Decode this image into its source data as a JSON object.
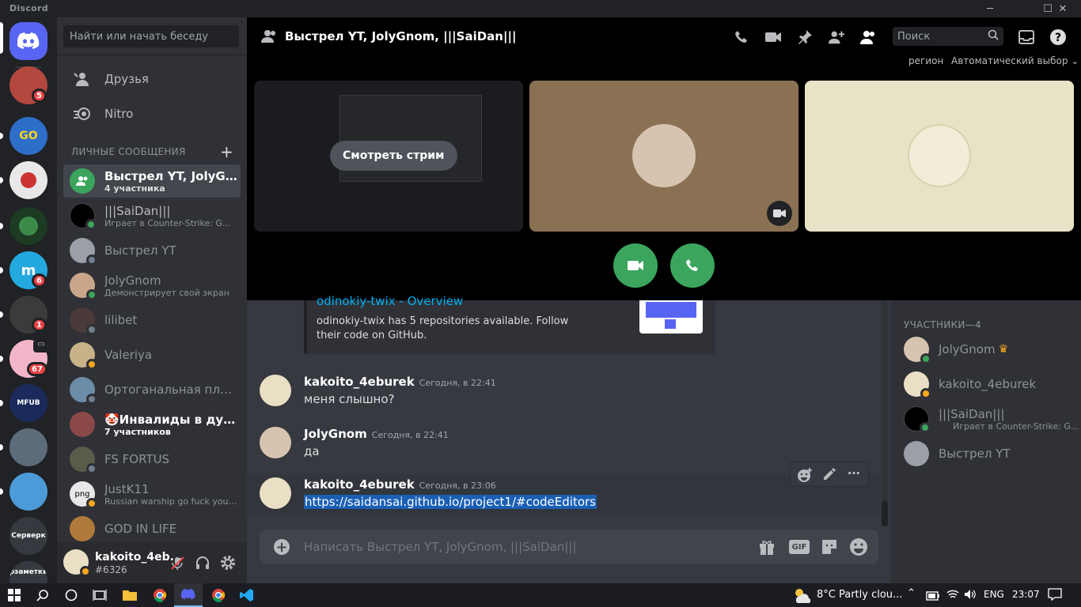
{
  "window": {
    "app_name": "Discord"
  },
  "guilds": {
    "badges": [
      "5",
      "6",
      "1",
      "67"
    ],
    "server_label": "Серверк",
    "notes_label": "рзаметки",
    "mfub_label": "MFUB"
  },
  "sidebar": {
    "search_placeholder": "Найти или начать беседу",
    "friends": "Друзья",
    "nitro": "Nitro",
    "dm_header": "ЛИЧНЫЕ СООБЩЕНИЯ",
    "dms": [
      {
        "name": "Выстрел YT, JolyGno...",
        "sub": "4 участника"
      },
      {
        "name": "|||SaiDan|||",
        "sub": "Играет в Counter-Strike: G..."
      },
      {
        "name": "Выстрел YT",
        "sub": ""
      },
      {
        "name": "JolyGnom",
        "sub": "Демонстрирует свой экран"
      },
      {
        "name": "lilibet",
        "sub": ""
      },
      {
        "name": "Valeriya",
        "sub": ""
      },
      {
        "name": "Ортоганальная площ...",
        "sub": ""
      },
      {
        "name": "🤡Инвалиды в дурке...",
        "sub": "7 участников"
      },
      {
        "name": "FS FORTUS",
        "sub": ""
      },
      {
        "name": "JustK11",
        "sub": "Russian warship go fuck yours..."
      },
      {
        "name": "GOD IN LIFE",
        "sub": ""
      }
    ]
  },
  "user": {
    "name": "kakoito_4eb...",
    "tag": "#6326"
  },
  "call": {
    "title": "Выстрел YT, JolyGnom, |||SaiDan|||",
    "search_placeholder": "Поиск",
    "region_label": "регион",
    "region_value": "Автоматический выбор",
    "watch_stream": "Смотреть стрим"
  },
  "chat": {
    "embed_title": "odinokiy-twix - Overview",
    "embed_text": "odinokiy-twix has 5 repositories available. Follow their code on GitHub.",
    "messages": [
      {
        "author": "kakoito_4eburek",
        "time": "Сегодня, в 22:41",
        "text": "меня слышно?"
      },
      {
        "author": "JolyGnom",
        "time": "Сегодня, в 22:41",
        "text": "да"
      },
      {
        "author": "kakoito_4eburek",
        "time": "Сегодня, в 23:06",
        "text": "https://saidansai.github.io/project1/#codeEditors"
      }
    ],
    "composer_placeholder": "Написать Выстрел YT, JolyGnom, |||SaiDan|||",
    "gif_label": "GIF"
  },
  "members": {
    "header": "УЧАСТНИКИ—4",
    "list": [
      {
        "name": "JolyGnom",
        "sub": ""
      },
      {
        "name": "kakoito_4eburek",
        "sub": ""
      },
      {
        "name": "|||SaiDan|||",
        "sub": "Играет в Counter-Strike: G..."
      },
      {
        "name": "Выстрел YT",
        "sub": ""
      }
    ]
  },
  "taskbar": {
    "weather": "8°C  Partly clou...",
    "lang": "ENG",
    "time": "23:07"
  },
  "colors": {
    "accent": "#5865f2",
    "green": "#3ba55d",
    "red": "#ed4245",
    "link": "#00aff4"
  }
}
